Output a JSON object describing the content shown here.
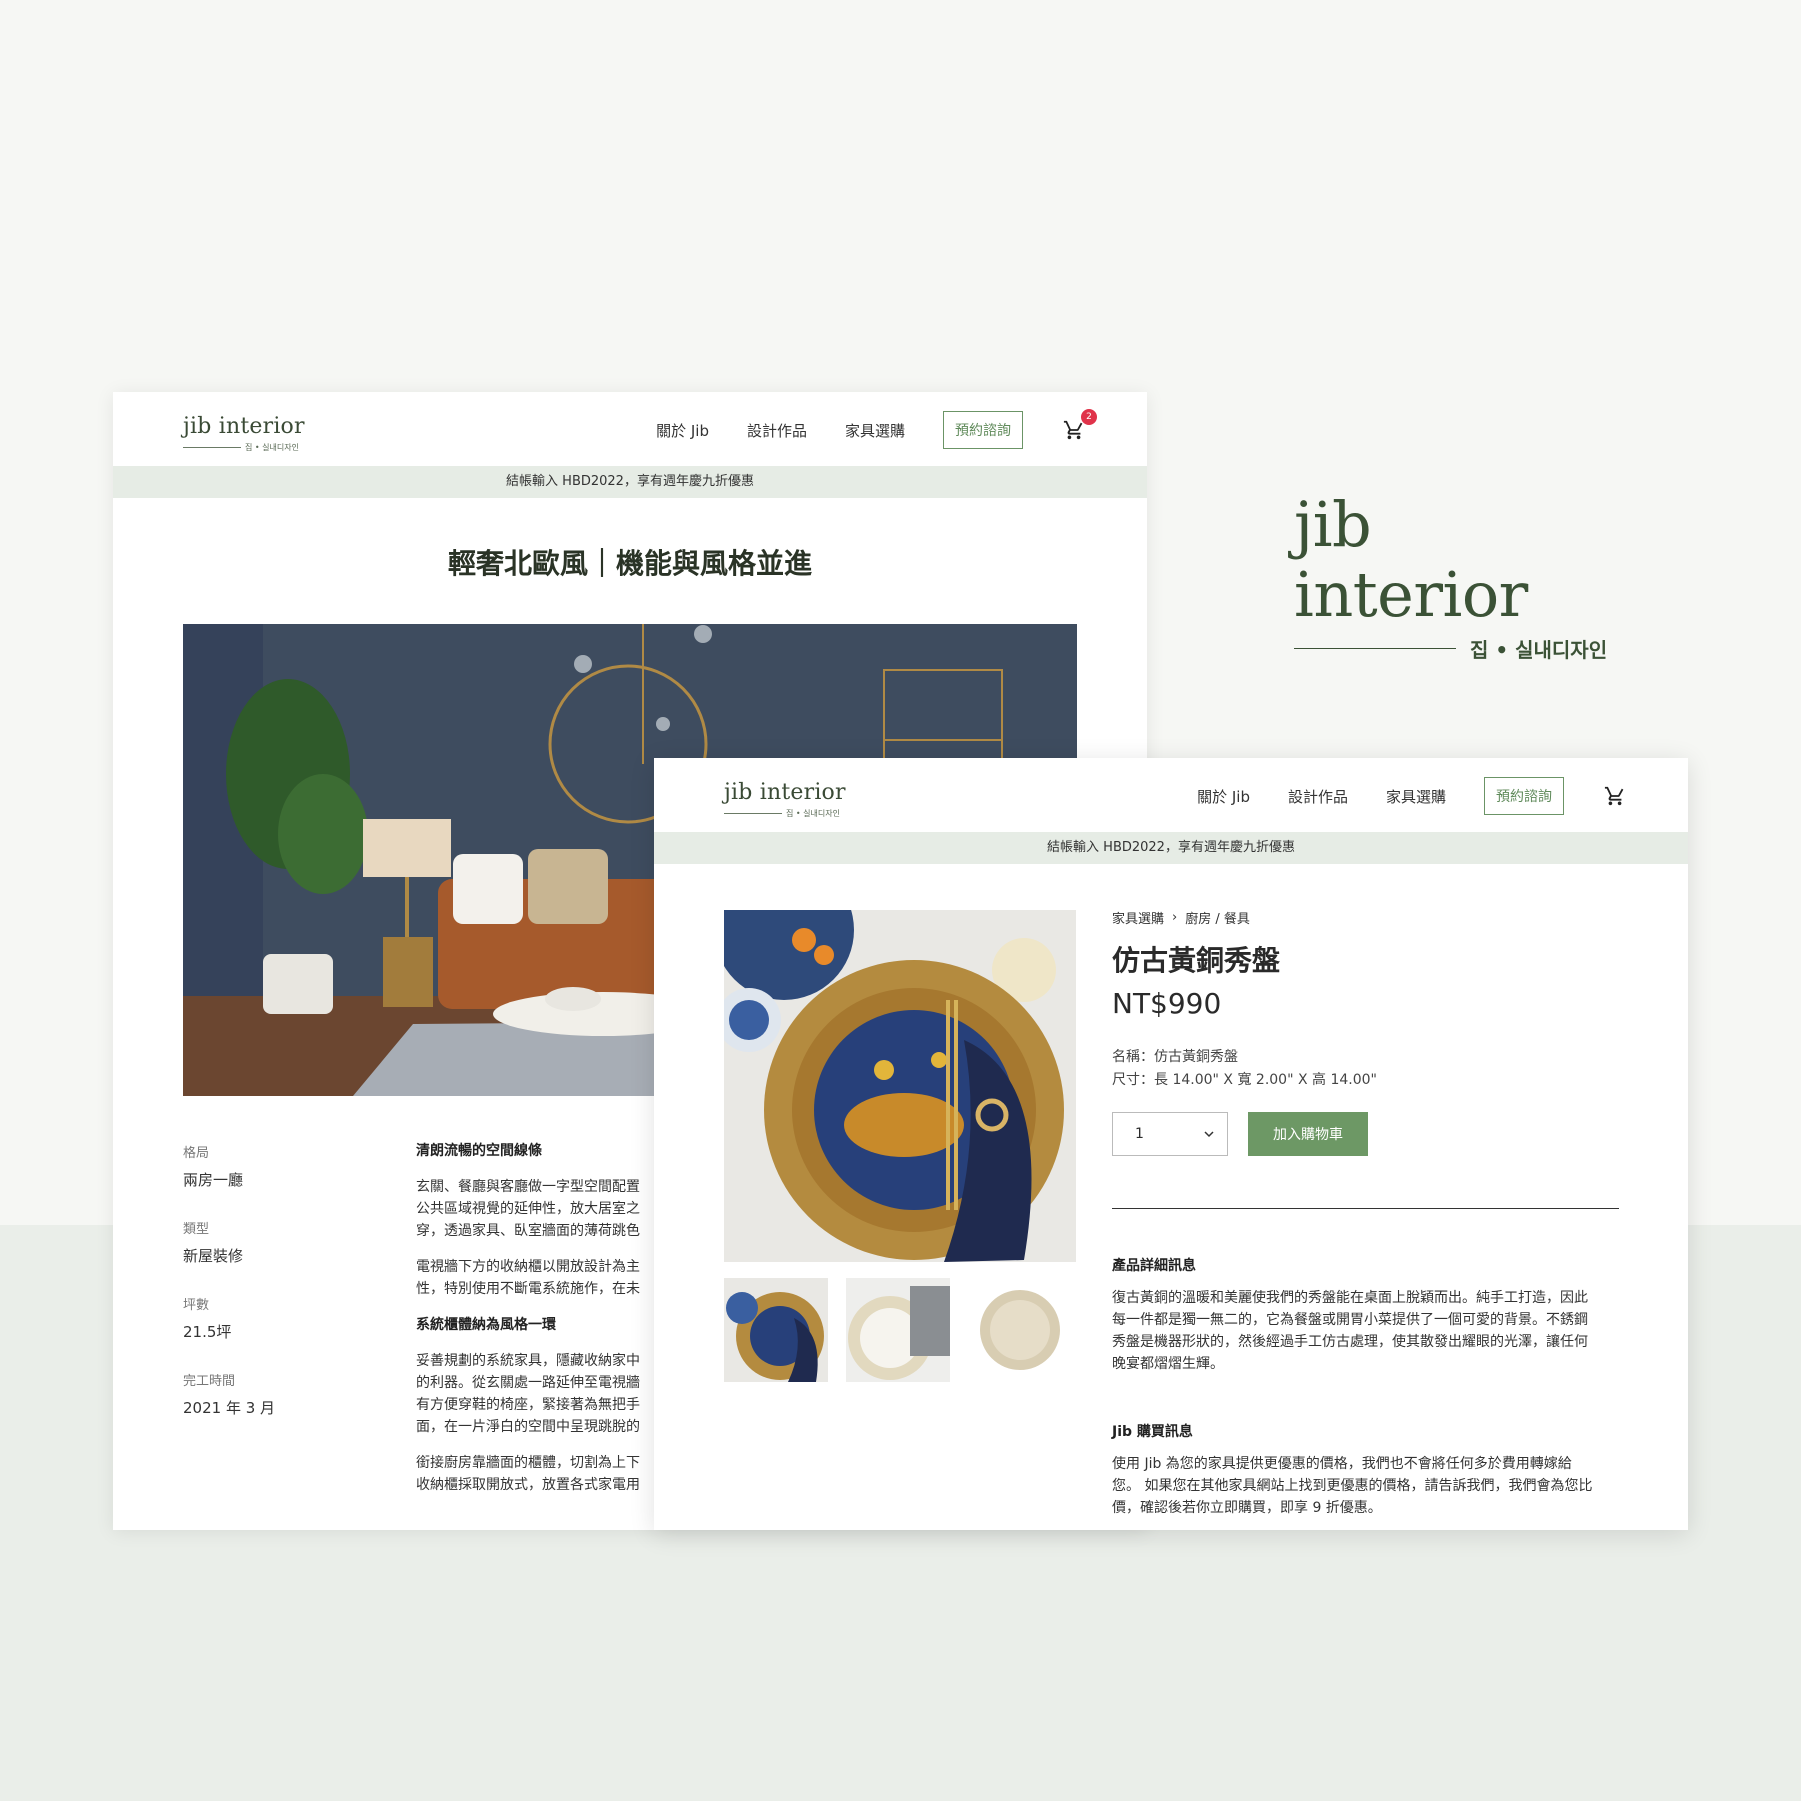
{
  "brand": {
    "name": "jib interior",
    "sub": "집 • 실내디자인"
  },
  "nav": {
    "about": "關於 Jib",
    "works": "設計作品",
    "furniture": "家具選購",
    "cta": "預約諮詢"
  },
  "cart": {
    "count": "2"
  },
  "promo": "結帳輸入 HBD2022，享有週年慶九折優惠",
  "article": {
    "title": "輕奢北歐風｜機能與風格並進",
    "specs": [
      {
        "label": "格局",
        "value": "兩房一廳"
      },
      {
        "label": "類型",
        "value": "新屋裝修"
      },
      {
        "label": "坪數",
        "value": "21.5坪"
      },
      {
        "label": "完工時間",
        "value": "2021 年 3 月"
      }
    ],
    "h1": "清朗流暢的空間線條",
    "p1": "玄關、餐廳與客廳做一字型空間配置\n公共區域視覺的延伸性，放大居室之\n穿，透過家具、臥室牆面的薄荷跳色",
    "p2": "電視牆下方的收納櫃以開放設計為主\n性，特別使用不斷電系統施作，在未",
    "h2": "系統櫃體納為風格一環",
    "p3": "妥善規劃的系統家具，隱藏收納家中\n的利器。從玄關處一路延伸至電視牆\n有方便穿鞋的椅座，緊接著為無把手\n面，在一片淨白的空間中呈現跳脫的",
    "p4": "銜接廚房靠牆面的櫃體，切割為上下\n收納櫃採取開放式，放置各式家電用"
  },
  "product": {
    "breadcrumb": [
      "家具選購",
      "廚房 / 餐具"
    ],
    "title": "仿古黃銅秀盤",
    "price": "NT$990",
    "name_line": "名稱：仿古黃銅秀盤",
    "size_line": "尺寸：長 14.00\" X 寬 2.00\" X 高 14.00\"",
    "qty": "1",
    "add_to_cart": "加入購物車",
    "detail_heading": "產品詳細訊息",
    "detail_text": "復古黃銅的溫暖和美麗使我們的秀盤能在桌面上脫穎而出。純手工打造，因此\n每一件都是獨一無二的，它為餐盤或開胃小菜提供了一個可愛的背景。不銹鋼\n秀盤是機器形狀的，然後經過手工仿古處理，使其散發出耀眼的光澤，讓任何\n晚宴都熠熠生輝。",
    "buy_heading": "Jib 購買訊息",
    "buy_text": "使用 Jib 為您的家具提供更優惠的價格，我們也不會將任何多於費用轉嫁給\n您。 如果您在其他家具網站上找到更優惠的價格，請告訴我們，我們會為您比\n價，確認後若你立即購買，即享 9 折優惠。"
  },
  "colors": {
    "brand_green": "#3b5236",
    "accent_green": "#6d9865",
    "promo_bg": "#e6ece5",
    "badge_red": "#e0334a"
  },
  "icons": [
    "cart-icon",
    "chevron-right-icon",
    "chevron-down-icon"
  ]
}
